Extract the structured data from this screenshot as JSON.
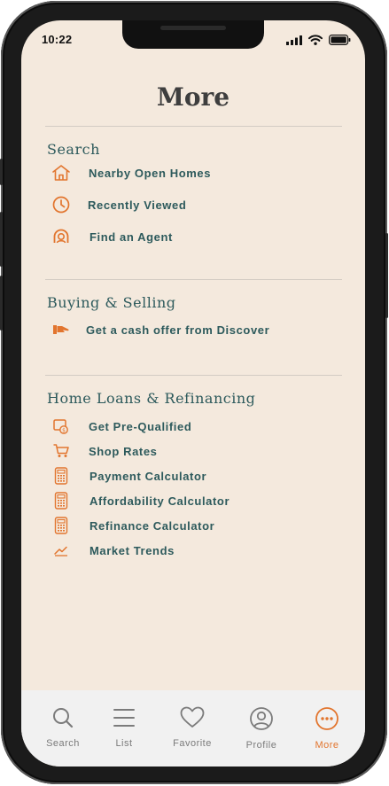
{
  "status": {
    "time": "10:22"
  },
  "page": {
    "title": "More"
  },
  "sections": [
    {
      "title": "Search",
      "items": [
        {
          "label": "Nearby Open Homes",
          "icon": "house-icon"
        },
        {
          "label": "Recently Viewed",
          "icon": "clock-icon"
        },
        {
          "label": "Find an Agent",
          "icon": "agent-icon"
        }
      ]
    },
    {
      "title": "Buying & Selling",
      "items": [
        {
          "label": "Get a cash offer from Discover",
          "icon": "cash-offer-icon"
        }
      ]
    },
    {
      "title": "Home Loans & Refinancing",
      "items": [
        {
          "label": "Get Pre-Qualified",
          "icon": "prequalified-icon"
        },
        {
          "label": "Shop Rates",
          "icon": "cart-icon"
        },
        {
          "label": "Payment Calculator",
          "icon": "calculator-icon"
        },
        {
          "label": "Affordability Calculator",
          "icon": "calculator-icon"
        },
        {
          "label": "Refinance Calculator",
          "icon": "calculator-icon"
        },
        {
          "label": "Market Trends",
          "icon": "trend-chart-icon"
        }
      ]
    }
  ],
  "tabs": [
    {
      "label": "Search",
      "icon": "search-icon",
      "active": false
    },
    {
      "label": "List",
      "icon": "list-icon",
      "active": false
    },
    {
      "label": "Favorite",
      "icon": "heart-icon",
      "active": false
    },
    {
      "label": "Profile",
      "icon": "profile-icon",
      "active": false
    },
    {
      "label": "More",
      "icon": "more-icon",
      "active": true
    }
  ],
  "colors": {
    "accent": "#e2752e",
    "text": "#2d5a5c",
    "background": "#f4e9dd",
    "tabbar": "#f1f1f1",
    "inactive": "#7b7b7b"
  }
}
